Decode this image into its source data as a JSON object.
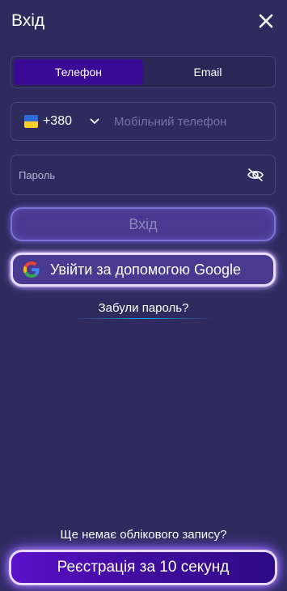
{
  "header": {
    "title": "Вхід",
    "close_icon": "close-icon"
  },
  "tabs": [
    {
      "label": "Телефон",
      "active": true
    },
    {
      "label": "Email",
      "active": false
    }
  ],
  "phone": {
    "flag_icon": "ukraine-flag-icon",
    "country_code": "+380",
    "dropdown_icon": "chevron-down-icon",
    "placeholder": "Мобільний телефон",
    "value": ""
  },
  "password": {
    "placeholder": "Пароль",
    "value": "",
    "toggle_icon": "eye-slash-icon"
  },
  "buttons": {
    "login_label": "Вхід",
    "google_label": "Увійти за допомогою Google",
    "google_icon": "google-icon"
  },
  "forgot_password": "Забули пароль?",
  "footer": {
    "no_account_text": "Ще немає облікового запису?",
    "register_label": "Реєстрація за 10 секунд"
  },
  "colors": {
    "background": "#2f2b5e",
    "active_tab": "#3a0a94",
    "field_border": "#48447c",
    "flag_blue": "#2f6bd8",
    "flag_yellow": "#f6cf2a",
    "register_gradient_start": "#5b10c9",
    "register_gradient_end": "#2e0b86"
  }
}
